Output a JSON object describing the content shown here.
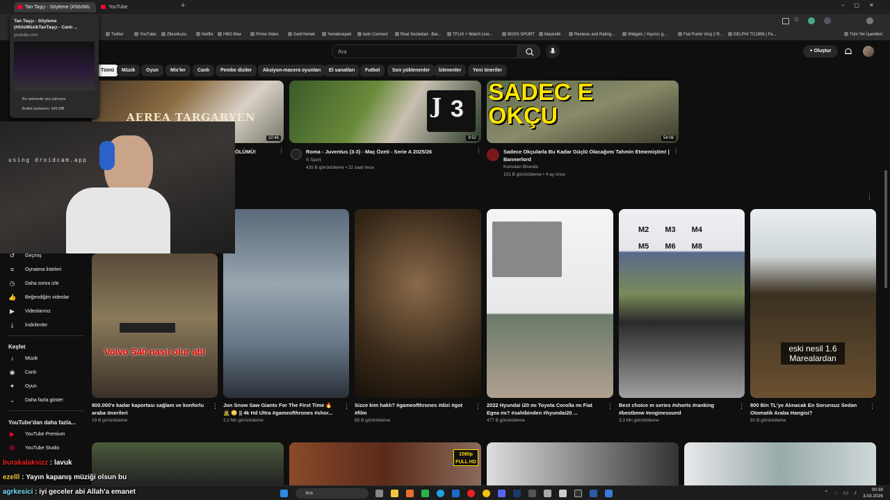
{
  "browser": {
    "tabs": [
      {
        "title": "Tan Taşçı - Söyleme (#SözMü",
        "active": true
      },
      {
        "title": "YouTube",
        "active": false
      }
    ],
    "tab_preview": {
      "title": "Tan Taşçı - Söyleme (#SözMüzikTanTaşçı - Canlı ...",
      "domain": "youtube.com",
      "sound": "Bu sekmede ses çalınıyor",
      "memory": "Bellek kullanımı: 545 MB"
    },
    "bookmarks": [
      "Twitter",
      "YouTube",
      "Zikuvikuzu",
      "Netflix",
      "HBO Max",
      "Prime Video",
      "GetirYemek",
      "Yemeksepeti",
      "beIn Connect",
      "Real Sociedad - Bar...",
      "TFLIX + Watch Live...",
      "BOSS SPORT",
      "Mackolik",
      "Reviews and Rating...",
      "Widgets | Yayıncı g...",
      "Fiat Punto Viraj 2 R...",
      "DELPHI TC1806 | Fa..."
    ],
    "all_bookmarks": "Tüm Yer İşaretleri"
  },
  "youtube": {
    "search_placeholder": "Ara",
    "create_label": "Oluştur",
    "chips": [
      "Tümü",
      "Müzik",
      "Oyun",
      "Mix'ler",
      "Canlı",
      "Pembe diziler",
      "Aksiyon-macera oyunları",
      "El sanatları",
      "Futbol",
      "Son yüklenenler",
      "İzlenenler",
      "Yeni öneriler"
    ],
    "sidebar": {
      "you_items": [
        "Geçmiş",
        "Oynatma listeleri",
        "Daha sonra izle",
        "Beğendiğim videolar",
        "Videolarınız",
        "İndirilenler"
      ],
      "explore_heading": "Keşfet",
      "explore_items": [
        "Müzik",
        "Canlı",
        "Oyun",
        "Daha fazla göster"
      ],
      "more_heading": "YouTube'dan daha fazla...",
      "more_items": [
        "YouTube Premium",
        "YouTube Studio"
      ]
    },
    "row1": [
      {
        "title": "ÖLÜMÜ!",
        "channel": "",
        "meta": "",
        "duration": "22:46",
        "overlay": "AEREA TARGARYEN"
      },
      {
        "title": "Roma - Juventus (3-3) - Maç Özeti - Serie A 2025/26",
        "channel": "S Sport",
        "meta": "435 B görüntüleme • 22 saat önce",
        "duration": "9:52",
        "overlay": "3"
      },
      {
        "title": "Sadece Okçularla Bu Kadar Güçlü Olacağımı Tahmin Etmemiştim! | Bannerlord",
        "channel": "Komutan Blrando",
        "meta": "101 B görüntüleme • 4 ay önce",
        "duration": "54:06",
        "overlay": "SADEC E OKÇU"
      }
    ],
    "shorts": [
      {
        "title": "800.000'e kadar kaportası sağlam ve konforlu araba önerileri",
        "meta": "19 B görüntüleme",
        "overlay": "Volvo S40 nasıl olur abi"
      },
      {
        "title": "Jon Snow Saw Giants For The First Time 🔥 🧟 😳 || 4k Hd Ultra #gameofthrones #shor...",
        "meta": "2,2 Mn görüntüleme",
        "overlay": ""
      },
      {
        "title": "Sizce kim haklı? #gameofthrones #dizi #got #film",
        "meta": "85 B görüntüleme",
        "overlay": ""
      },
      {
        "title": "2022 Hyundai i20 mı Toyota Corolla mı Fiat Egea mı? #sahibinden #hyundai20 ...",
        "meta": "477 B görüntüleme",
        "overlay": ""
      },
      {
        "title": "Best choice m series #shorts #ranking #bestbmw #enginesound",
        "meta": "3,3 Mn görüntüleme",
        "overlay": "M2 M3 M4 M5 M6 M8"
      },
      {
        "title": "800 Bin TL'ye Alınacak En Sorunsuz Sedan Otomatik Araba Hangisi?",
        "meta": "91 B görüntüleme",
        "overlay": "eski nesil 1.6 Marealardan"
      }
    ],
    "row3_overlays": [
      "1080p FULL HD"
    ]
  },
  "stream": {
    "cam_text": "using droidcam.app",
    "chat": [
      {
        "user": "burakalaksizz",
        "msg": "lavuk"
      },
      {
        "user": "ezelll",
        "msg": "Yayın kapanış müziği olsun bu"
      },
      {
        "user": "agrkesici",
        "msg": "iyi geceler abi Allah'a emanet"
      }
    ]
  },
  "taskbar": {
    "search": "Ara",
    "time": "00:39",
    "date": "3.03.2026"
  },
  "colors": {
    "accent": "#ff0033",
    "bg": "#0f0f0f",
    "chip": "#272727"
  }
}
